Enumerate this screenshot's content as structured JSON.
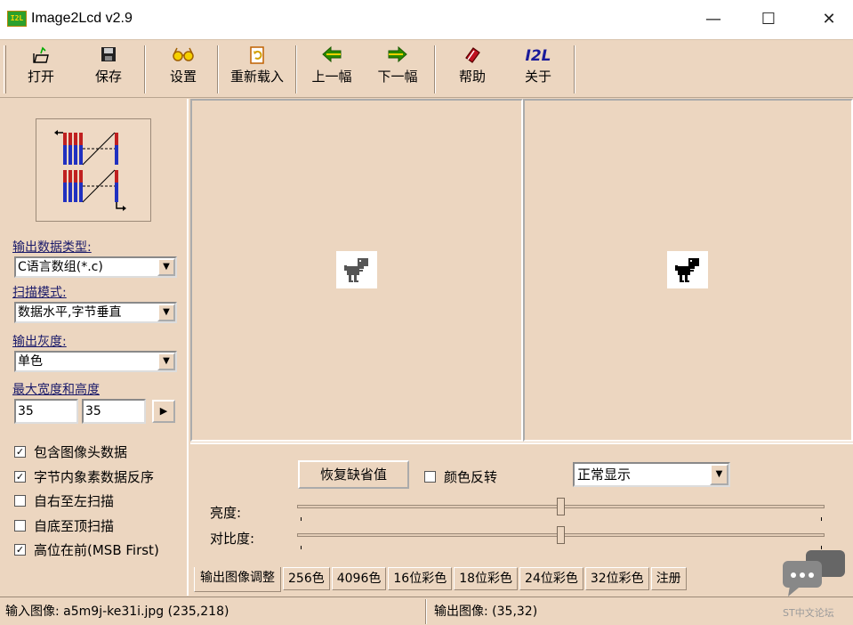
{
  "window": {
    "icon_text": "I2L",
    "title": "Image2Lcd v2.9",
    "minimize_glyph": "—",
    "maximize_glyph": "☐",
    "close_glyph": "✕"
  },
  "toolbar": {
    "buttons": [
      {
        "label": "打开",
        "icon": "open-folder-icon"
      },
      {
        "label": "保存",
        "icon": "floppy-disk-icon"
      },
      {
        "label": "设置",
        "icon": "glasses-icon"
      },
      {
        "label": "重新载入",
        "icon": "reload-document-icon"
      },
      {
        "label": "上一幅",
        "icon": "arrow-left-icon"
      },
      {
        "label": "下一幅",
        "icon": "arrow-right-icon"
      },
      {
        "label": "帮助",
        "icon": "help-book-icon"
      },
      {
        "label": "关于",
        "icon": "i2l-logo-icon"
      }
    ],
    "about_icon_text": "I2L"
  },
  "settings": {
    "output_type_label": "输出数据类型:",
    "output_type_value": "C语言数组(*.c)",
    "scan_mode_label": "扫描模式:",
    "scan_mode_value": "数据水平,字节垂直",
    "gray_label": "输出灰度:",
    "gray_value": "单色",
    "size_label": "最大宽度和高度",
    "max_width": "35",
    "max_height": "35",
    "checkboxes": [
      {
        "label": "包含图像头数据",
        "checked": true
      },
      {
        "label": "字节内象素数据反序",
        "checked": true
      },
      {
        "label": "自右至左扫描",
        "checked": false
      },
      {
        "label": "自底至顶扫描",
        "checked": false
      },
      {
        "label": "高位在前(MSB First)",
        "checked": true
      }
    ]
  },
  "adjust": {
    "restore_label": "恢复缺省值",
    "invert_label": "颜色反转",
    "display_mode": "正常显示",
    "brightness_label": "亮度:",
    "contrast_label": "对比度:",
    "brightness_level": 0.5,
    "contrast_level": 0.5
  },
  "tabs": [
    "输出图像调整",
    "256色",
    "4096色",
    "16位彩色",
    "18位彩色",
    "24位彩色",
    "32位彩色",
    "注册"
  ],
  "status": {
    "input": "输入图像: a5m9j-ke31i.jpg (235,218)",
    "output": "输出图像: (35,32)"
  },
  "watermark": {
    "text": "ST中文论坛"
  },
  "colors": {
    "background": "#ecd6c0",
    "accent": "#2ca02c"
  }
}
